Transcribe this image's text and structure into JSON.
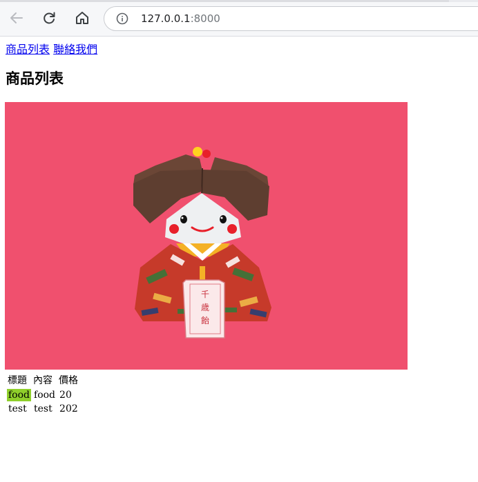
{
  "browser": {
    "url_host": "127.0.0.1",
    "url_port": ":8000",
    "icons": [
      "back-arrow-icon",
      "reload-icon",
      "home-icon",
      "info-icon"
    ]
  },
  "nav": {
    "links": [
      {
        "label": "商品列表"
      },
      {
        "label": "聯絡我們"
      }
    ]
  },
  "page": {
    "title": "商品列表"
  },
  "image": {
    "tag_text": "千歳飴",
    "background_color": "#f0506e"
  },
  "table": {
    "headers": [
      "標題",
      "內容",
      "價格"
    ],
    "rows": [
      {
        "title": "food",
        "content": "food",
        "price": "20",
        "title_highlight_color": "#8fcf2b"
      },
      {
        "title": "test",
        "content": "test",
        "price": "202"
      }
    ]
  }
}
